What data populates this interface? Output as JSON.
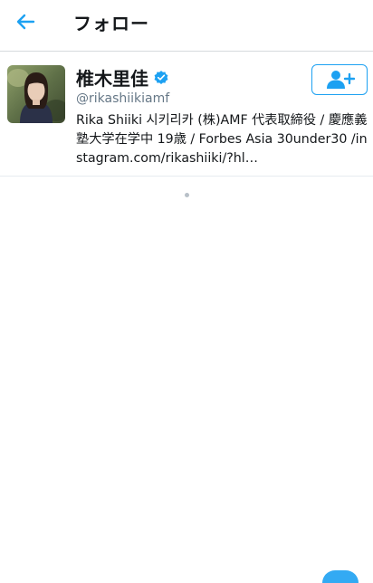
{
  "header": {
    "title": "フォロー",
    "back_icon": "arrow-left-icon"
  },
  "user": {
    "display_name": "椎木里佳",
    "verified": true,
    "handle": "@rikashiikiamf",
    "bio": "Rika Shiiki 시키리카 (株)AMF 代表取締役 / 慶應義塾大学在学中 19歳 / Forbes Asia 30under30 /instagram.com/rikashiiki/?hl…",
    "follow_icon": "add-user-icon"
  },
  "colors": {
    "accent": "#1da1f2",
    "text": "#14171a",
    "secondary_text": "#657786"
  }
}
